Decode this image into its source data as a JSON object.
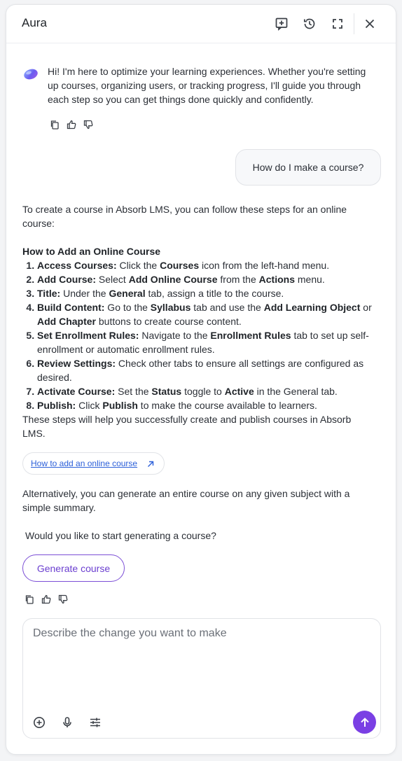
{
  "header": {
    "title": "Aura",
    "icons": [
      "new-chat-icon",
      "history-icon",
      "fullscreen-icon",
      "close-icon"
    ]
  },
  "greeting": {
    "text": "Hi! I'm here to optimize your learning experiences. Whether you're setting up courses, organizing users, or tracking progress, I'll guide you through each step so you can get things done quickly and confidently."
  },
  "user_message": {
    "text": "How do I make a course?"
  },
  "answer": {
    "intro": "To create a course in Absorb LMS, you can follow these steps for an online course:",
    "heading": "How to Add an Online Course",
    "steps": [
      {
        "label": "Access Courses:",
        "parts": [
          " Click the ",
          {
            "b": "Courses"
          },
          " icon from the left-hand menu."
        ]
      },
      {
        "label": "Add Course:",
        "parts": [
          " Select ",
          {
            "b": "Add Online Course"
          },
          " from the ",
          {
            "b": "Actions"
          },
          " menu."
        ]
      },
      {
        "label": "Title:",
        "parts": [
          " Under the ",
          {
            "b": "General"
          },
          " tab, assign a title to the course."
        ]
      },
      {
        "label": "Build Content:",
        "parts": [
          " Go to the ",
          {
            "b": "Syllabus"
          },
          " tab and use the ",
          {
            "b": "Add Learning Object"
          },
          " or ",
          {
            "b": "Add Chapter"
          },
          " buttons to create course content."
        ]
      },
      {
        "label": "Set Enrollment Rules:",
        "parts": [
          " Navigate to the ",
          {
            "b": "Enrollment Rules"
          },
          " tab to set up self-enrollment or automatic enrollment rules."
        ]
      },
      {
        "label": "Review Settings:",
        "parts": [
          " Check other tabs to ensure all settings are configured as desired."
        ]
      },
      {
        "label": "Activate Course:",
        "parts": [
          " Set the ",
          {
            "b": "Status"
          },
          " toggle to ",
          {
            "b": "Active"
          },
          " in the General tab."
        ]
      },
      {
        "label": "Publish:",
        "parts": [
          " Click ",
          {
            "b": "Publish"
          },
          " to make the course available to learners."
        ]
      }
    ],
    "outro": "These steps will help you successfully create and publish courses in Absorb LMS.",
    "link_label": "How to add an online course",
    "alternative": "Alternatively, you can generate an entire course on any given subject with a simple summary.",
    "question": "Would you like to start generating a course?",
    "generate_button": "Generate course"
  },
  "composer": {
    "placeholder": "Describe the change you want to make",
    "value": ""
  },
  "colors": {
    "accent": "#7a3fe4",
    "link": "#2b5fd9"
  }
}
